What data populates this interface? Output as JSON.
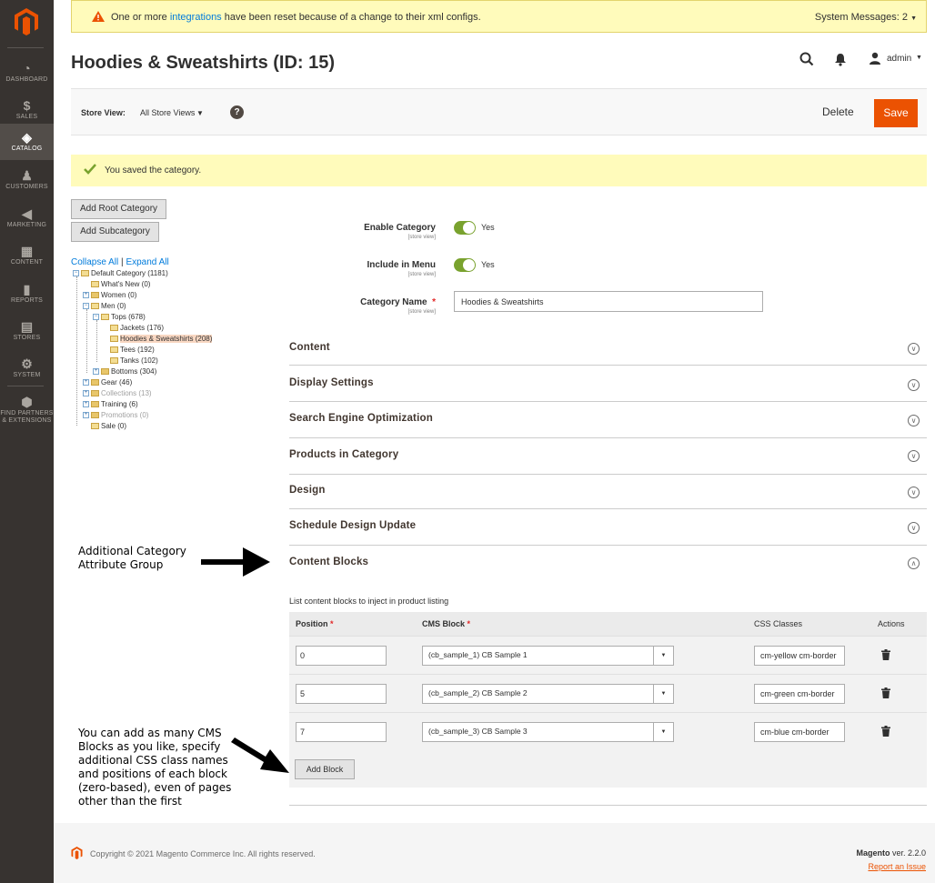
{
  "sidebar": {
    "items": [
      {
        "label": "DASHBOARD",
        "icon": "dashboard-icon"
      },
      {
        "label": "SALES",
        "icon": "dollar-icon"
      },
      {
        "label": "CATALOG",
        "icon": "box-icon"
      },
      {
        "label": "CUSTOMERS",
        "icon": "person-icon"
      },
      {
        "label": "MARKETING",
        "icon": "megaphone-icon"
      },
      {
        "label": "CONTENT",
        "icon": "layout-icon"
      },
      {
        "label": "REPORTS",
        "icon": "bar-chart-icon"
      },
      {
        "label": "STORES",
        "icon": "storefront-icon"
      },
      {
        "label": "SYSTEM",
        "icon": "gear-icon"
      },
      {
        "label": "FIND PARTNERS",
        "icon": "cube-icon"
      }
    ],
    "partners_line2": "& EXTENSIONS"
  },
  "system_message": {
    "before": "One or more ",
    "link": "integrations",
    "after": " have been reset because of a change to their xml configs.",
    "count": "System Messages: 2"
  },
  "page": {
    "title": "Hoodies & Sweatshirts (ID: 15)"
  },
  "header": {
    "user": "admin"
  },
  "store_view": {
    "label": "Store View:",
    "value": "All Store Views",
    "help": "?"
  },
  "actions": {
    "delete": "Delete",
    "save": "Save"
  },
  "success_message": "You saved the category.",
  "tree_buttons": {
    "add_root": "Add Root Category",
    "add_sub": "Add Subcategory"
  },
  "tree_links": {
    "collapse": "Collapse All",
    "sep": "|",
    "expand": "Expand All"
  },
  "tree": [
    {
      "label": "Default Category (1181)"
    },
    {
      "label": "What's New (0)"
    },
    {
      "label": "Women (0)"
    },
    {
      "label": "Men (0)"
    },
    {
      "label": "Tops (678)"
    },
    {
      "label": "Jackets (176)"
    },
    {
      "label": "Hoodies & Sweatshirts (208)"
    },
    {
      "label": "Tees (192)"
    },
    {
      "label": "Tanks (102)"
    },
    {
      "label": "Bottoms (304)"
    },
    {
      "label": "Gear (46)"
    },
    {
      "label": "Collections (13)"
    },
    {
      "label": "Training (6)"
    },
    {
      "label": "Promotions (0)"
    },
    {
      "label": "Sale (0)"
    }
  ],
  "form": {
    "scope": "[store view]",
    "enable": {
      "label": "Enable Category",
      "value": "Yes"
    },
    "menu": {
      "label": "Include in Menu",
      "value": "Yes"
    },
    "name": {
      "label": "Category Name",
      "required": "*",
      "value": "Hoodies & Sweatshirts"
    }
  },
  "sections": [
    "Content",
    "Display Settings",
    "Search Engine Optimization",
    "Products in Category",
    "Design",
    "Schedule Design Update",
    "Content Blocks"
  ],
  "content_blocks": {
    "description": "List content blocks to inject in product listing",
    "headers": {
      "position": "Position",
      "cms_block": "CMS Block",
      "css": "CSS Classes",
      "actions": "Actions",
      "required": "*"
    },
    "rows": [
      {
        "position": "0",
        "block": "(cb_sample_1) CB Sample 1",
        "css": "cm-yellow cm-border"
      },
      {
        "position": "5",
        "block": "(cb_sample_2) CB Sample 2",
        "css": "cm-green cm-border"
      },
      {
        "position": "7",
        "block": "(cb_sample_3) CB Sample 3",
        "css": "cm-blue cm-border"
      }
    ],
    "add_button": "Add Block"
  },
  "annotations": {
    "group": [
      "Additional  Category",
      "Attribute Group"
    ],
    "blocks": [
      "You can add as many CMS",
      "Blocks as you like, specify",
      "additional CSS class names",
      "and positions of each block",
      "(zero-based), even of pages",
      "other than the first"
    ]
  },
  "footer": {
    "copyright": "Copyright © 2021 Magento Commerce Inc. All rights reserved.",
    "brand": "Magento",
    "version": " ver. 2.2.0",
    "report": "Report an Issue"
  },
  "colors": {
    "accent": "#eb5202",
    "sidebar": "#373330",
    "toggle_on": "#79a22e",
    "notice": "#fffbbb"
  }
}
